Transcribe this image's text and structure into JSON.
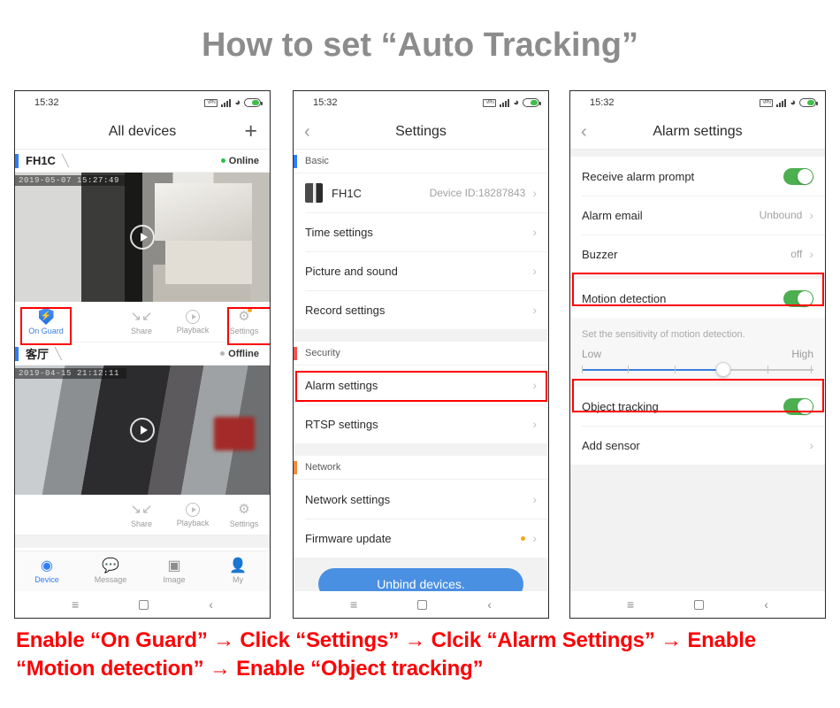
{
  "title": "How to set “Auto Tracking”",
  "caption": "Enable “On Guard” → Click “Settings” → Clcik “Alarm Settings” → Enable “Motion detection” → Enable “Object tracking”",
  "colors": {
    "accent_red": "#ff0000",
    "caption_red": "#fd0005",
    "title_gray": "#8c8c8c",
    "toggle_green": "#4caf50",
    "primary_blue": "#2f7dfb",
    "button_blue": "#4a90e2",
    "badge_orange": "#f5a623",
    "online_green": "#24c24a"
  },
  "statusbar": {
    "time": "15:32",
    "icons": [
      "vpn-icon",
      "signal-icon",
      "wifi-icon",
      "battery-icon"
    ],
    "vpn_label": "VPN"
  },
  "phone1": {
    "header": {
      "title": "All devices",
      "add_label": "+"
    },
    "devices": [
      {
        "name": "FH1C",
        "edit_icon": "pencil-icon",
        "status": "Online",
        "status_state": "online",
        "timestamp": "2019-05-07  15:27:49",
        "actions": {
          "on_guard": "On Guard",
          "share": "Share",
          "playback": "Playback",
          "settings": "Settings"
        }
      },
      {
        "name": "客厅",
        "edit_icon": "pencil-icon",
        "status": "Offline",
        "status_state": "offline",
        "timestamp": "2019-04-15  21:12:11",
        "actions": {
          "share": "Share",
          "playback": "Playback",
          "settings": "Settings"
        }
      }
    ],
    "tabs": [
      {
        "label": "Device",
        "icon": "camera-icon",
        "active": true
      },
      {
        "label": "Message",
        "icon": "chat-icon",
        "active": false
      },
      {
        "label": "Image",
        "icon": "picture-icon",
        "active": false
      },
      {
        "label": "My",
        "icon": "person-icon",
        "active": false
      }
    ]
  },
  "phone2": {
    "header": {
      "title": "Settings",
      "back": "‹"
    },
    "sections": [
      {
        "label": "Basic",
        "accent": "blue",
        "rows": [
          {
            "label": "FH1C",
            "value": "Device ID:18287843",
            "thumb": true
          },
          {
            "label": "Time settings",
            "value": ""
          },
          {
            "label": "Picture and sound",
            "value": ""
          },
          {
            "label": "Record settings",
            "value": ""
          }
        ]
      },
      {
        "label": "Security",
        "accent": "red",
        "rows": [
          {
            "label": "Alarm settings",
            "value": "",
            "highlight": true
          },
          {
            "label": "RTSP settings",
            "value": ""
          }
        ]
      },
      {
        "label": "Network",
        "accent": "orange",
        "rows": [
          {
            "label": "Network settings",
            "value": ""
          },
          {
            "label": "Firmware update",
            "value": "",
            "badge": true
          }
        ]
      }
    ],
    "unbind_label": "Unbind devices."
  },
  "phone3": {
    "header": {
      "title": "Alarm settings",
      "back": "‹"
    },
    "rows": [
      {
        "label": "Receive alarm prompt",
        "control": "toggle",
        "state": "on"
      },
      {
        "label": "Alarm email",
        "control": "value",
        "value": "Unbound"
      },
      {
        "label": "Buzzer",
        "control": "value",
        "value": "off"
      },
      {
        "label": "Motion detection",
        "control": "toggle",
        "state": "on",
        "highlight": true
      },
      {
        "label": "Object tracking",
        "control": "toggle",
        "state": "on",
        "highlight": true
      },
      {
        "label": "Add sensor",
        "control": "chevron"
      }
    ],
    "sensitivity": {
      "hint": "Set the sensitivity of motion detection.",
      "low_label": "Low",
      "high_label": "High",
      "value_percent": 61
    }
  },
  "softkeys": {
    "menu": "≡",
    "home": "home-square-icon",
    "back": "‹"
  }
}
